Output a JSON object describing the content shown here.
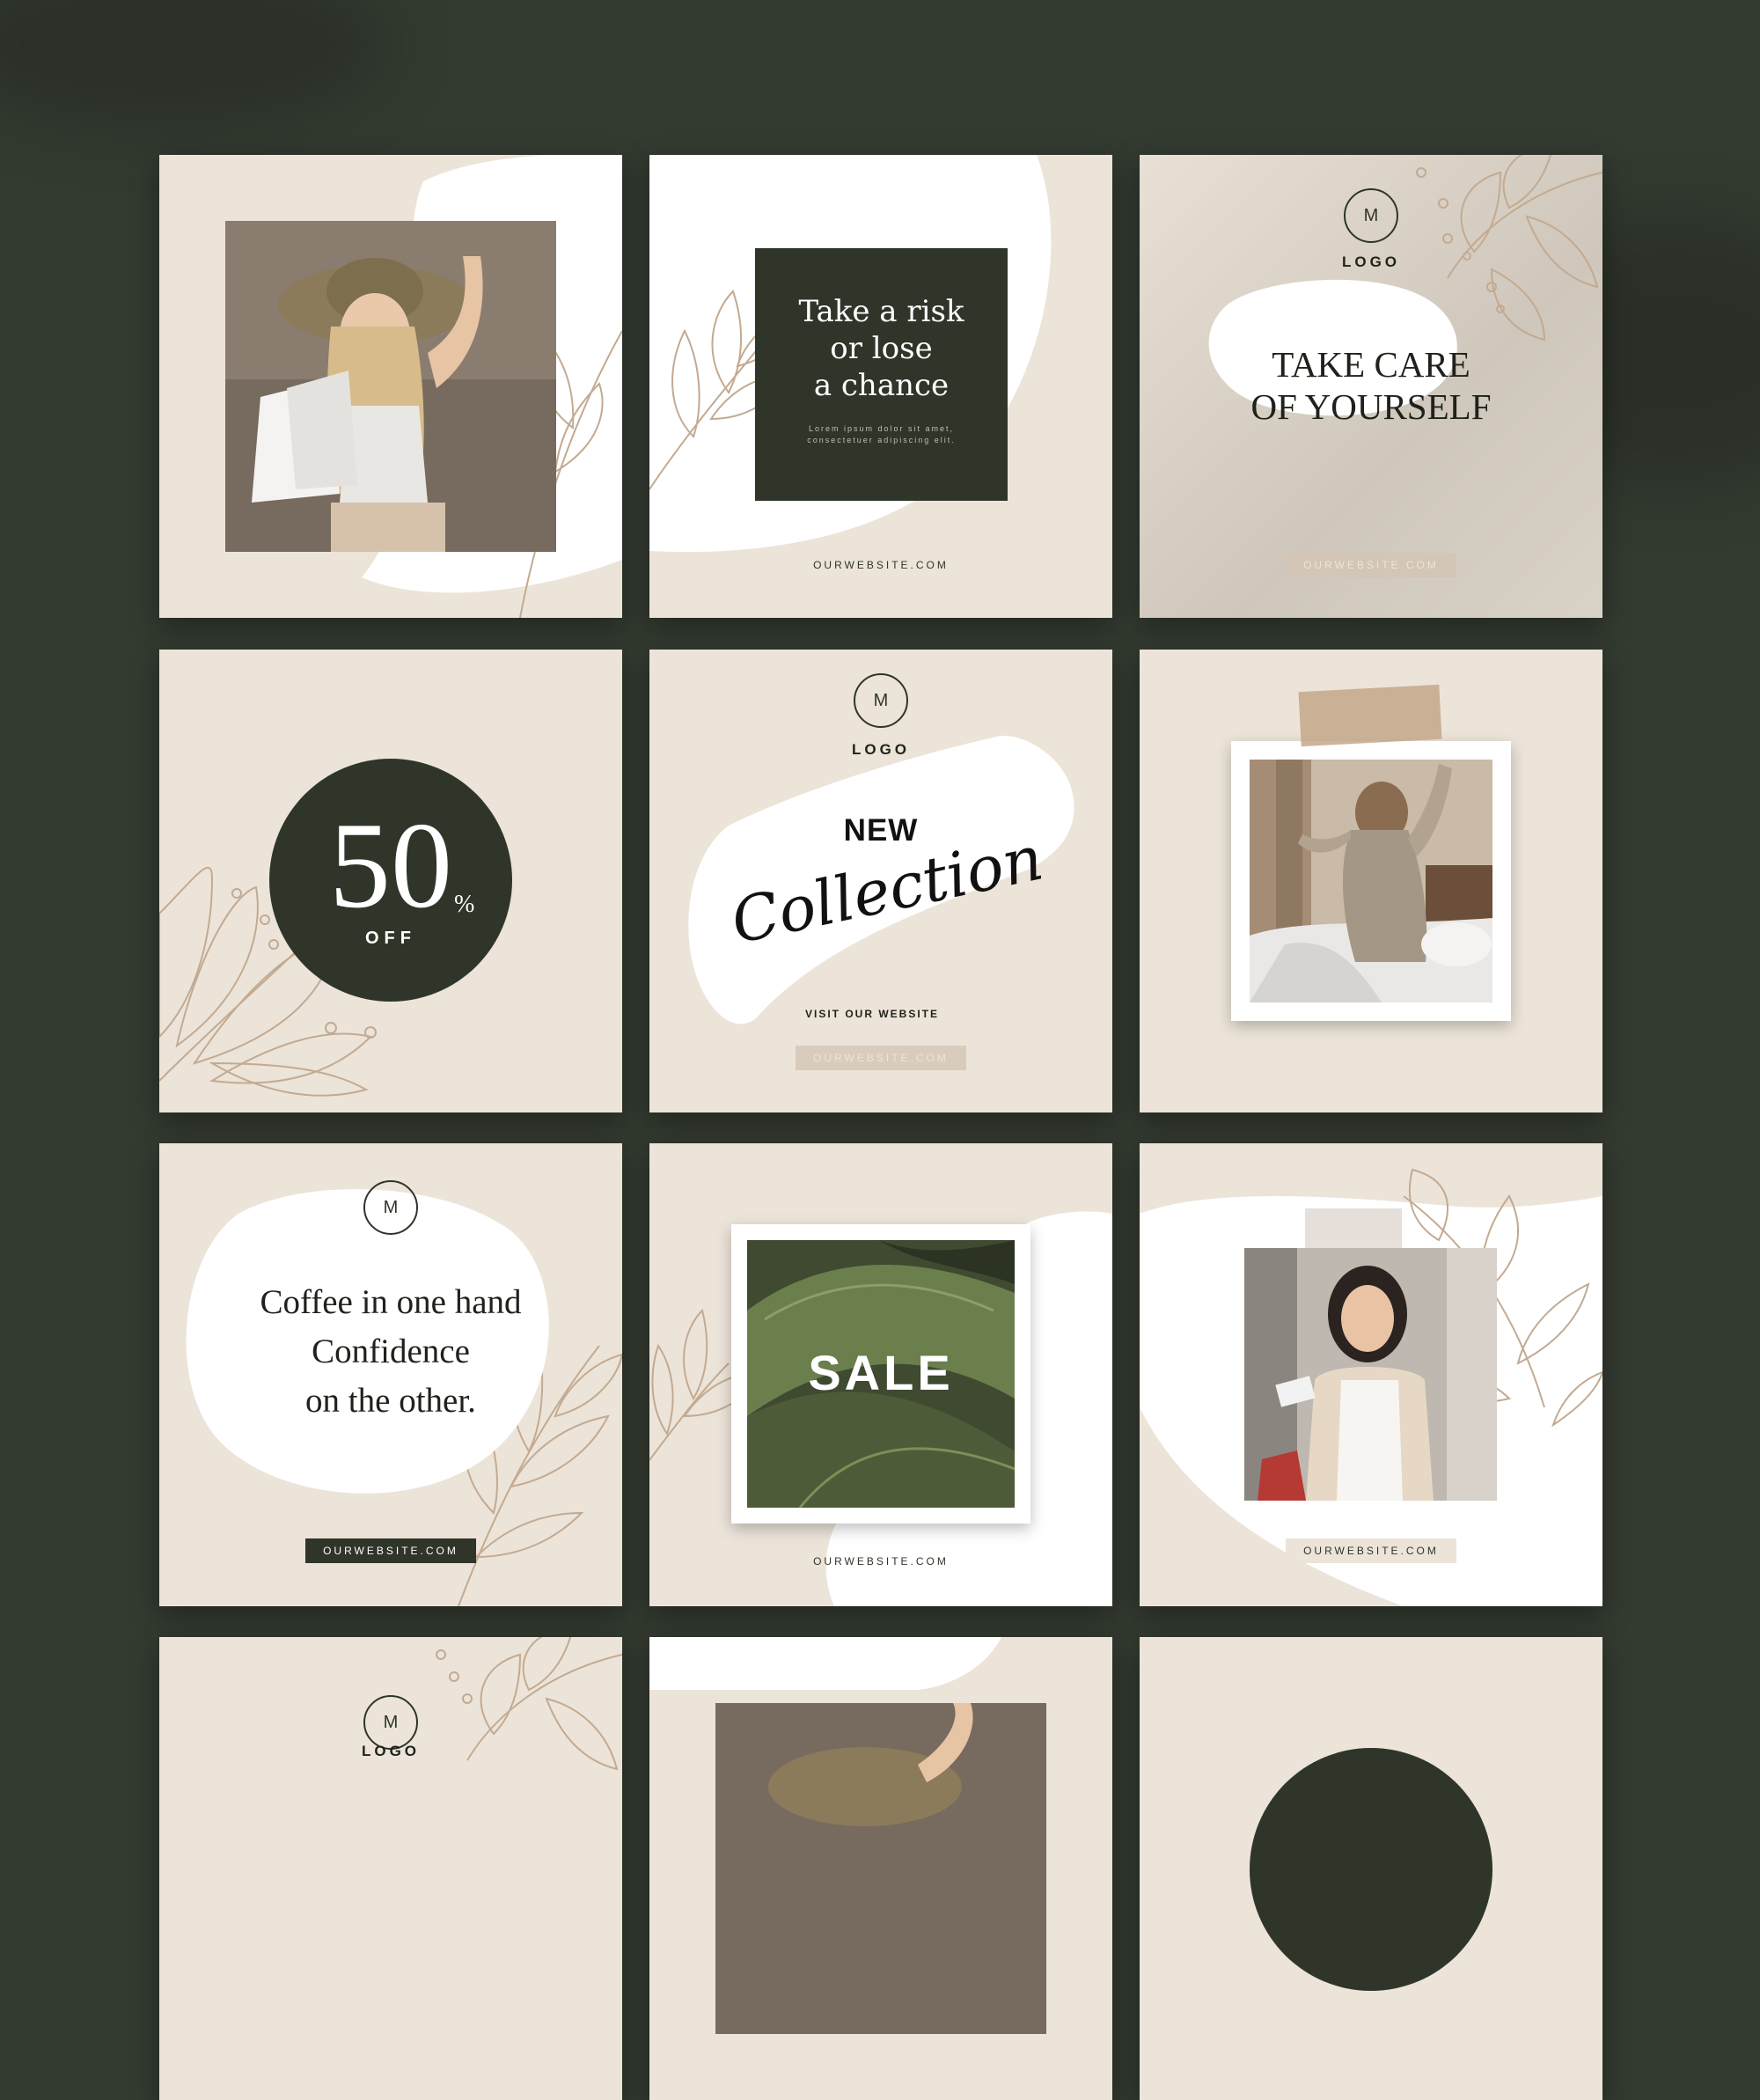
{
  "colors": {
    "background": "#333a30",
    "beige": "#ece4d9",
    "dark_green": "#2f3529",
    "tan_line": "#c3aa91",
    "white": "#ffffff"
  },
  "cards": {
    "c2": {
      "quote_l1": "Take a risk",
      "quote_l2": "or lose",
      "quote_l3": "a chance",
      "lorem_l1": "Lorem ipsum dolor sit amet,",
      "lorem_l2": "consectetuer adipiscing elit.",
      "url": "OURWEBSITE.COM"
    },
    "c3": {
      "logo_letter": "M",
      "logo_label": "LOGO",
      "headline_l1": "TAKE CARE",
      "headline_l2": "OF YOURSELF",
      "url": "OURWEBSITE.COM"
    },
    "c4": {
      "number": "50",
      "percent": "%",
      "off": "OFF"
    },
    "c5": {
      "logo_letter": "M",
      "logo_label": "LOGO",
      "new": "NEW",
      "collection": "Collection",
      "visit": "VISIT OUR WEBSITE",
      "url": "OURWEBSITE.COM"
    },
    "c7": {
      "logo_letter": "M",
      "quote_l1": "Coffee in one hand",
      "quote_l2": "Confidence",
      "quote_l3": "on the other.",
      "url": "OURWEBSITE.COM"
    },
    "c8": {
      "sale": "SALE",
      "url": "OURWEBSITE.COM"
    },
    "c9": {
      "url": "OURWEBSITE.COM"
    },
    "c10": {
      "logo_letter": "M",
      "logo_label": "LOGO"
    }
  }
}
